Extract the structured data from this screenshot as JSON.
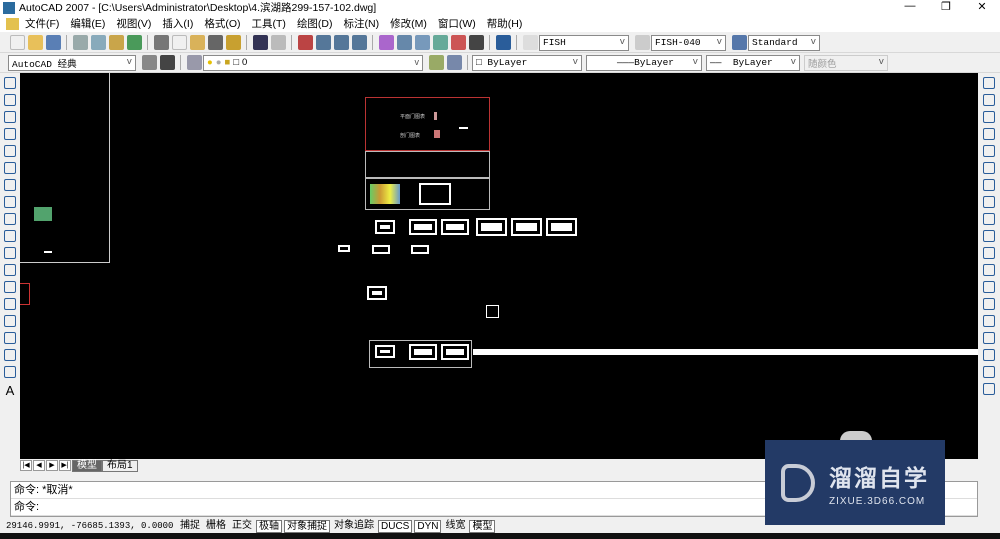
{
  "title": "AutoCAD 2007 - [C:\\Users\\Administrator\\Desktop\\4.滨湖路299-157-102.dwg]",
  "window_controls": [
    "—",
    "❐",
    "✕"
  ],
  "menu": [
    "文件(F)",
    "编辑(E)",
    "视图(V)",
    "插入(I)",
    "格式(O)",
    "工具(T)",
    "绘图(D)",
    "标注(N)",
    "修改(M)",
    "窗口(W)",
    "帮助(H)"
  ],
  "toolbar": {
    "text_style": "FISH",
    "dim_style": "FISH-040",
    "table_style": "Standard",
    "workspace": "AutoCAD 经典",
    "layer": "0",
    "color": "ByLayer",
    "linetype": "ByLayer",
    "lineweight": "ByLayer",
    "plotstyle": "随颜色"
  },
  "drawing": {
    "label1": "平面门图表",
    "label2": "剖门图表"
  },
  "tabs": [
    "模型",
    "布局1"
  ],
  "command": {
    "history": "命令: *取消*",
    "prompt": "命令:"
  },
  "status": {
    "coords": "29146.9991, -76685.1393, 0.0000",
    "buttons": [
      {
        "label": "捕捉",
        "on": false
      },
      {
        "label": "栅格",
        "on": false
      },
      {
        "label": "正交",
        "on": false
      },
      {
        "label": "极轴",
        "on": true
      },
      {
        "label": "对象捕捉",
        "on": true
      },
      {
        "label": "对象追踪",
        "on": false
      },
      {
        "label": "DUCS",
        "on": true
      },
      {
        "label": "DYN",
        "on": true
      },
      {
        "label": "线宽",
        "on": false
      },
      {
        "label": "模型",
        "on": true
      }
    ]
  },
  "watermark": {
    "name": "溜溜自学",
    "url": "ZIXUE.3D66.COM"
  }
}
